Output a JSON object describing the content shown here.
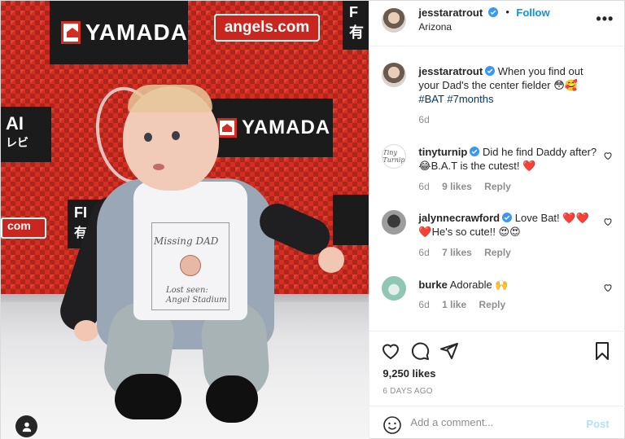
{
  "header": {
    "username": "jesstaratrout",
    "separator": "•",
    "follow_label": "Follow",
    "location": "Arizona",
    "more_label": "•••"
  },
  "photo": {
    "sponsor_1": "YAMADA",
    "sponsor_2": "angels.com",
    "sponsor_3": "YAMADA",
    "left_sign": "AI",
    "left_sign_2": "レビ",
    "left_sign_3": "com",
    "mid_sign": "FI",
    "mid_sign_2": "有",
    "top_right_sign": "F",
    "top_right_sign_2": "有",
    "shirt_line_1": "Missing DAD",
    "shirt_line_2": "Lost seen:",
    "shirt_line_3": "Angel Stadium"
  },
  "caption": {
    "username": "jesstaratrout",
    "text": "When you find out your Dad's the center fielder 😳🥰",
    "hashtag_1": "#BAT",
    "hashtag_2": "#7months",
    "time": "6d"
  },
  "comments": [
    {
      "username": "tinyturnip",
      "avatar_text": "Tiny Turnip",
      "text": "Did he find Daddy after? 😂B.A.T is the cutest! ❤️",
      "time": "6d",
      "likes": "9 likes",
      "reply": "Reply"
    },
    {
      "username": "jalynnecrawford",
      "text": "Love Bat! ❤️❤️ ❤️He's so cute!! 😍😍",
      "time": "6d",
      "likes": "7 likes",
      "reply": "Reply"
    },
    {
      "username": "burke",
      "text": "Adorable 🙌",
      "time": "6d",
      "likes": "1 like",
      "reply": "Reply"
    }
  ],
  "stats": {
    "likes": "9,250 likes",
    "posted": "6 DAYS AGO"
  },
  "add_comment": {
    "placeholder": "Add a comment...",
    "post_label": "Post"
  },
  "colors": {
    "accent": "#0095f6",
    "verified": "#3897f0",
    "post_disabled": "#b2dffc"
  }
}
